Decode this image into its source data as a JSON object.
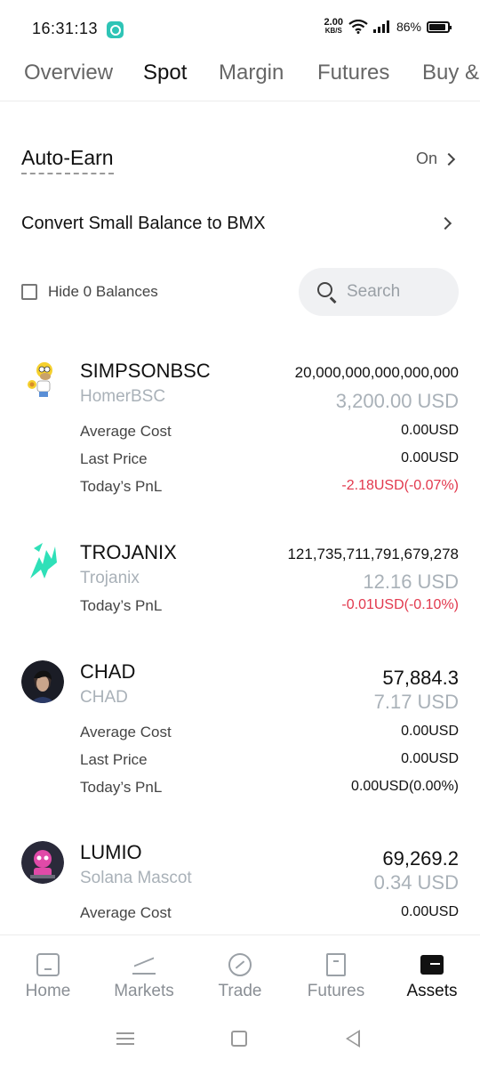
{
  "status": {
    "time": "16:31:13",
    "net_speed_value": "2.00",
    "net_speed_unit": "KB/S",
    "battery": "86%"
  },
  "tabs": [
    {
      "label": "Overview",
      "active": false
    },
    {
      "label": "Spot",
      "active": true
    },
    {
      "label": "Margin",
      "active": false
    },
    {
      "label": "Futures",
      "active": false
    },
    {
      "label": "Buy &",
      "active": false
    }
  ],
  "auto_earn": {
    "label": "Auto-Earn",
    "status": "On"
  },
  "convert": {
    "label": "Convert Small Balance to BMX"
  },
  "hide_zero": {
    "label": "Hide 0 Balances",
    "checked": false
  },
  "search": {
    "placeholder": "Search"
  },
  "assets": [
    {
      "symbol": "SIMPSONBSC",
      "name": "HomerBSC",
      "quantity": "20,000,000,000,000,000",
      "usd": "3,200.00 USD",
      "average_cost_label": "Average Cost",
      "average_cost": "0.00USD",
      "last_price_label": "Last Price",
      "last_price": "0.00USD",
      "pnl_label": "Today’s PnL",
      "pnl": "-2.18USD(-0.07%)",
      "pnl_color": "#e2384d"
    },
    {
      "symbol": "TROJANIX",
      "name": "Trojanix",
      "quantity": "121,735,711,791,679,278",
      "usd": "12.16 USD",
      "pnl_label": "Today’s PnL",
      "pnl": "-0.01USD(-0.10%)",
      "pnl_color": "#e2384d"
    },
    {
      "symbol": "CHAD",
      "name": "CHAD",
      "quantity": "57,884.3",
      "usd": "7.17 USD",
      "average_cost_label": "Average Cost",
      "average_cost": "0.00USD",
      "last_price_label": "Last Price",
      "last_price": "0.00USD",
      "pnl_label": "Today’s PnL",
      "pnl": "0.00USD(0.00%)",
      "pnl_color": "#111111"
    },
    {
      "symbol": "LUMIO",
      "name": "Solana Mascot",
      "quantity": "69,269.2",
      "usd": "0.34 USD",
      "average_cost_label": "Average Cost",
      "average_cost": "0.00USD"
    }
  ],
  "bottom_nav": [
    {
      "label": "Home",
      "icon": "home-icon",
      "active": false
    },
    {
      "label": "Markets",
      "icon": "markets-icon",
      "active": false
    },
    {
      "label": "Trade",
      "icon": "trade-icon",
      "active": false
    },
    {
      "label": "Futures",
      "icon": "futures-icon",
      "active": false
    },
    {
      "label": "Assets",
      "icon": "assets-icon",
      "active": true
    }
  ],
  "colors": {
    "negative": "#e2384d",
    "muted": "#a9b1b8",
    "search_bg": "#f0f1f3"
  }
}
